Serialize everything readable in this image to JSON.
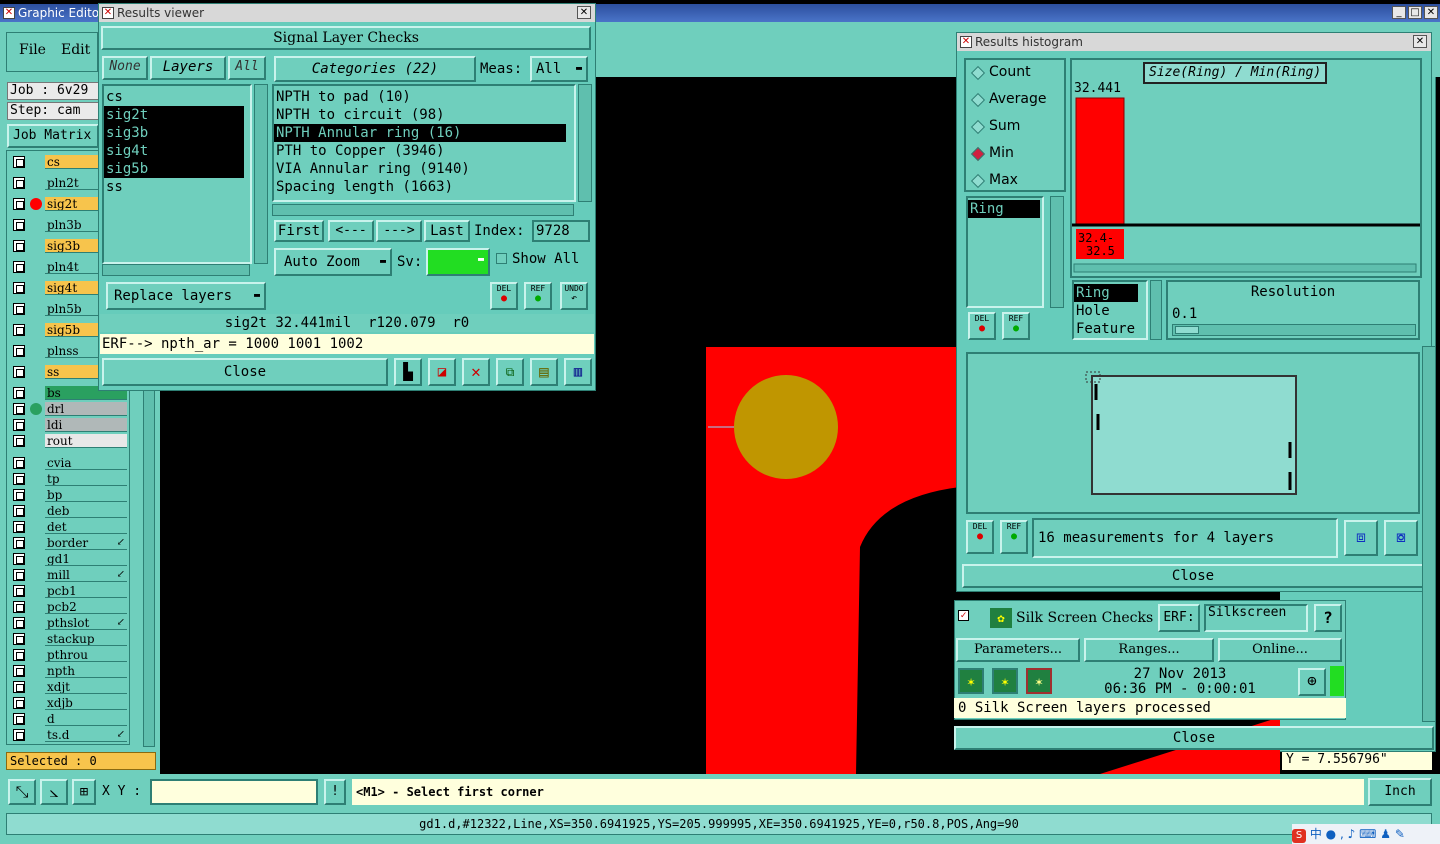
{
  "colors": {
    "teal": "#66ccbb",
    "red": "#ff0000",
    "pad": "#c09600",
    "yellow": "#f7c44c",
    "status_bg": "#ffffdd"
  },
  "main": {
    "title": "Graphic Editor",
    "menu": [
      "File",
      "Edit"
    ],
    "job_label": "Job : 6v29",
    "step_label": "Step: cam",
    "job_matrix": "Job Matrix",
    "layers": [
      {
        "name": "cs",
        "color": "yellow"
      },
      {
        "name": "pln2t",
        "color": "teal"
      },
      {
        "name": "sig2t",
        "color": "yellow",
        "active": true
      },
      {
        "name": "pln3b",
        "color": "teal"
      },
      {
        "name": "sig3b",
        "color": "yellow"
      },
      {
        "name": "pln4t",
        "color": "teal"
      },
      {
        "name": "sig4t",
        "color": "yellow"
      },
      {
        "name": "pln5b",
        "color": "teal"
      },
      {
        "name": "sig5b",
        "color": "yellow"
      },
      {
        "name": "plnss",
        "color": "teal"
      },
      {
        "name": "ss",
        "color": "yellow"
      },
      {
        "name": "bs",
        "color": "green"
      }
    ],
    "drill_layers": [
      "drl",
      "ldi",
      "rout"
    ],
    "misc_layers": [
      "cvia",
      "tp",
      "bp",
      "deb",
      "det",
      "border",
      "gd1",
      "mill",
      "pcb1",
      "pcb2",
      "pthslot",
      "stackup",
      "pthrou",
      "npth",
      "xdjt",
      "xdjb",
      "d",
      "ts.d"
    ],
    "selected": "Selected : 0",
    "xy_label": "X Y :",
    "prompt": "<M1> - Select first corner",
    "units": "Inch",
    "y_readout": "Y = 7.556796\"",
    "status_line": "gd1.d,#12322,Line,XS=350.6941925,YS=205.999995,XE=350.6941925,YE=0,r50.8,POS,Ang=90"
  },
  "results_viewer": {
    "title": "Results viewer",
    "heading": "Signal Layer Checks",
    "none_btn": "None",
    "layers_btn": "Layers",
    "all_btn": "All",
    "layers": [
      "cs",
      "sig2t",
      "sig3b",
      "sig4t",
      "sig5b",
      "ss"
    ],
    "categories_btn": "Categories (22)",
    "meas_label": "Meas:",
    "meas_value": "All",
    "categories": [
      "NPTH to pad (10)",
      "NPTH to circuit (98)",
      "NPTH Annular ring (16)",
      "PTH to Copper (3946)",
      "VIA Annular ring (9140)",
      "Spacing length (1663)"
    ],
    "nav": {
      "first": "First",
      "prev": "<---",
      "next": "--->",
      "last": "Last"
    },
    "index_label": "Index:",
    "index_value": "9728",
    "auto_zoom": "Auto Zoom",
    "sv_label": "Sv:",
    "show_all": "Show All",
    "replace_layers": "Replace layers",
    "del": "DEL",
    "ref": "REF",
    "undo": "UNDO",
    "result_line": "sig2t 32.441mil  r120.079  r0",
    "erf_line": "ERF--> npth_ar = 1000 1001 1002",
    "close": "Close"
  },
  "histogram": {
    "title": "Results histogram",
    "modes": [
      "Count",
      "Average",
      "Sum",
      "Min",
      "Max"
    ],
    "selected_mode": "Min",
    "left_list": [
      "Ring"
    ],
    "chart_title": "Size(Ring) / Min(Ring)",
    "resolution_label": "Resolution",
    "resolution_value": "0.1",
    "types": [
      "Ring",
      "Hole",
      "Feature"
    ],
    "summary": "16 measurements for 4 layers",
    "close": "Close",
    "chart_data": {
      "type": "bar",
      "categories": [
        "32.4-32.5"
      ],
      "values": [
        32.441
      ],
      "bar_label": "32.441",
      "category_label_lines": [
        "32.4-",
        "32.5"
      ]
    }
  },
  "silk": {
    "label": "Silk Screen Checks",
    "erf_btn": "ERF:",
    "erf_value": "Silkscreen",
    "help": "?",
    "params": "Parameters...",
    "ranges": "Ranges...",
    "online": "Online...",
    "date": "27 Nov 2013",
    "time": "06:36 PM - 0:00:01",
    "status": "0 Silk Screen layers processed",
    "close": "Close"
  },
  "tray": {
    "ime": "中"
  }
}
